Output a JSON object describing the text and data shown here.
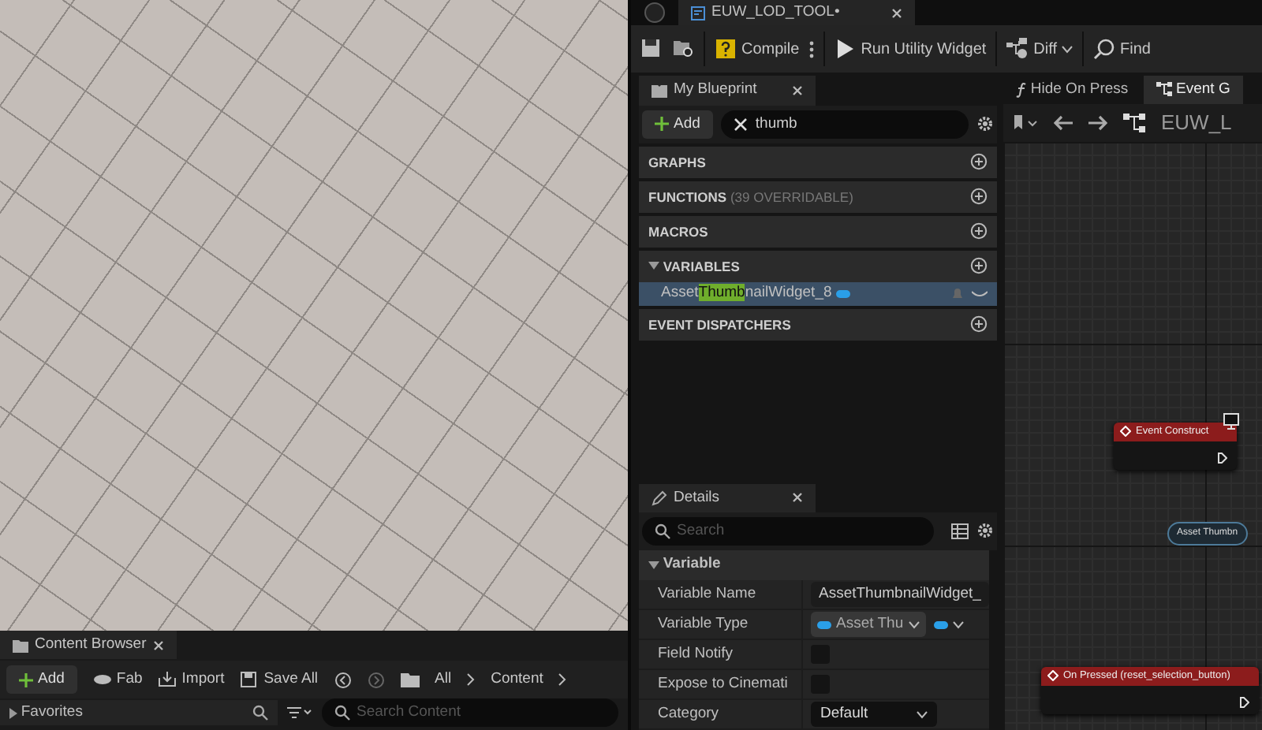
{
  "viewport": {
    "kind": "render"
  },
  "content_browser": {
    "tab": "Content Browser",
    "actions": [
      {
        "kind": "add",
        "label": "Add"
      },
      {
        "kind": "fab",
        "label": "Fab"
      },
      {
        "kind": "import",
        "label": "Import"
      },
      {
        "kind": "save",
        "label": "Save All"
      }
    ],
    "path": [
      "All",
      "Content"
    ],
    "favorites": {
      "label": "Favorites",
      "expanded": false
    },
    "search": {
      "placeholder": "Search Content"
    }
  },
  "editor_tab": {
    "title": "EUW_LOD_TOOL•"
  },
  "toolbar": [
    {
      "kind": "save"
    },
    {
      "kind": "browse"
    },
    {
      "kind": "compile",
      "label": "Compile"
    },
    {
      "kind": "run",
      "label": "Run Utility Widget"
    },
    {
      "kind": "diff",
      "label": "Diff"
    },
    {
      "kind": "find",
      "label": "Find"
    }
  ],
  "my_blueprint": {
    "title": "My Blueprint",
    "add": "Add",
    "search": {
      "value": "thumb"
    },
    "sections": [
      {
        "label": "GRAPHS",
        "expanded": false
      },
      {
        "label": "FUNCTIONS",
        "note": "(39 OVERRIDABLE)",
        "expanded": false
      },
      {
        "label": "MACROS",
        "expanded": false
      },
      {
        "label": "VARIABLES",
        "expanded": true,
        "items": [
          {
            "before": "Asset",
            "match": "Thumb",
            "after": "nailWidget_8",
            "selected": true
          }
        ]
      },
      {
        "label": "EVENT DISPATCHERS",
        "expanded": false
      }
    ]
  },
  "details": {
    "title": "Details",
    "search": {
      "placeholder": "Search"
    },
    "category": {
      "label": "Variable",
      "expanded": true
    },
    "properties": [
      {
        "kind": "text",
        "label": "Variable Name",
        "value": "AssetThumbnailWidget_"
      },
      {
        "kind": "type",
        "label": "Variable Type",
        "value": "Asset Thu"
      },
      {
        "kind": "checkbox",
        "label": "Field Notify",
        "checked": false
      },
      {
        "kind": "checkbox",
        "label": "Expose to Cinemati",
        "checked": false
      },
      {
        "kind": "dropdown",
        "label": "Category",
        "value": "Default"
      }
    ]
  },
  "graph": {
    "tabs": [
      {
        "label": "Hide On Press",
        "kind": "function",
        "selected": false
      },
      {
        "label": "Event G",
        "kind": "graph",
        "selected": true
      }
    ],
    "breadcrumb": "EUW_L",
    "nodes": [
      {
        "kind": "event",
        "title": "Event Construct"
      },
      {
        "kind": "variable",
        "title": "Asset Thumbn"
      },
      {
        "kind": "event",
        "title": "On Pressed (reset_selection_button)"
      }
    ]
  }
}
